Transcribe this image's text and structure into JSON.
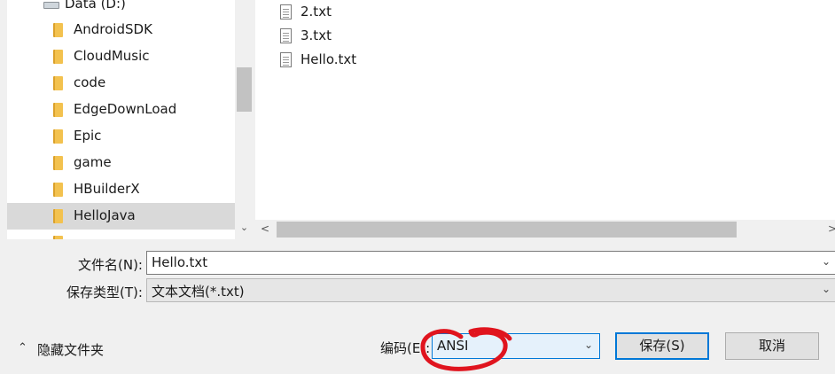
{
  "left_nav": {
    "drive": "Data (D:)",
    "folders": [
      {
        "label": "AndroidSDK"
      },
      {
        "label": "CloudMusic"
      },
      {
        "label": "code"
      },
      {
        "label": "EdgeDownLoad"
      },
      {
        "label": "Epic"
      },
      {
        "label": "game"
      },
      {
        "label": "HBuilderX"
      },
      {
        "label": "HelloJava",
        "selected": true
      }
    ]
  },
  "files": [
    {
      "name": "2.txt"
    },
    {
      "name": "3.txt"
    },
    {
      "name": "Hello.txt"
    }
  ],
  "form": {
    "filename_label": "文件名(N):",
    "filename_value": "Hello.txt",
    "filetype_label": "保存类型(T):",
    "filetype_value": "文本文档(*.txt)",
    "encoding_label": "编码(E):",
    "encoding_value": "ANSI",
    "save_label": "保存(S)",
    "cancel_label": "取消",
    "hide_folders_label": "隐藏文件夹"
  },
  "annotation": {
    "color": "#e0141e"
  },
  "icons": {
    "drive": "drive-icon",
    "folder": "folder-icon",
    "file": "text-file-icon",
    "chevron": "chevron-down-icon",
    "collapse": "chevron-up-icon"
  }
}
